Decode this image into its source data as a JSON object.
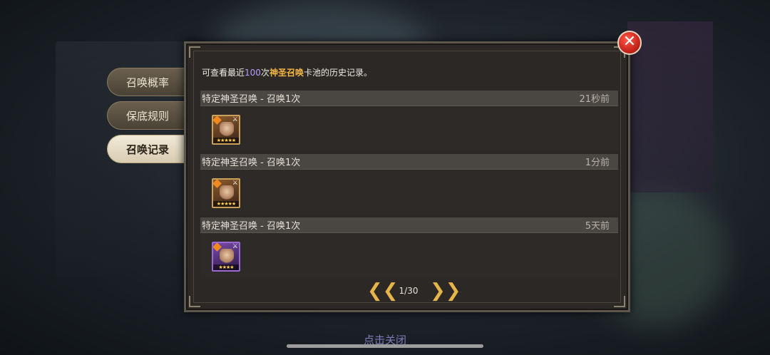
{
  "tabs": [
    {
      "label": "召唤概率",
      "active": false
    },
    {
      "label": "保底规则",
      "active": false
    },
    {
      "label": "召唤记录",
      "active": true
    }
  ],
  "notice": {
    "prefix": "可查看最近",
    "count": "100",
    "middle": "次",
    "pool": "神圣召唤",
    "suffix": "卡池的历史记录。"
  },
  "records": [
    {
      "title": "特定神圣召唤 - 召唤1次",
      "time": "21秒前",
      "hero_rarity": "gold",
      "stars": "★★★★★"
    },
    {
      "title": "特定神圣召唤 - 召唤1次",
      "time": "1分前",
      "hero_rarity": "gold",
      "stars": "★★★★★"
    },
    {
      "title": "特定神圣召唤 - 召唤1次",
      "time": "5天前",
      "hero_rarity": "purple",
      "stars": "★★★★"
    }
  ],
  "pager": {
    "text": "1/30",
    "prev": "❮❮",
    "next": "❯❯"
  },
  "close_icon": "✕",
  "tap_close": "点击关闭",
  "colors": {
    "accent_gold": "#f5b642",
    "accent_purple": "#b99cff",
    "close_red": "#c8251b"
  }
}
